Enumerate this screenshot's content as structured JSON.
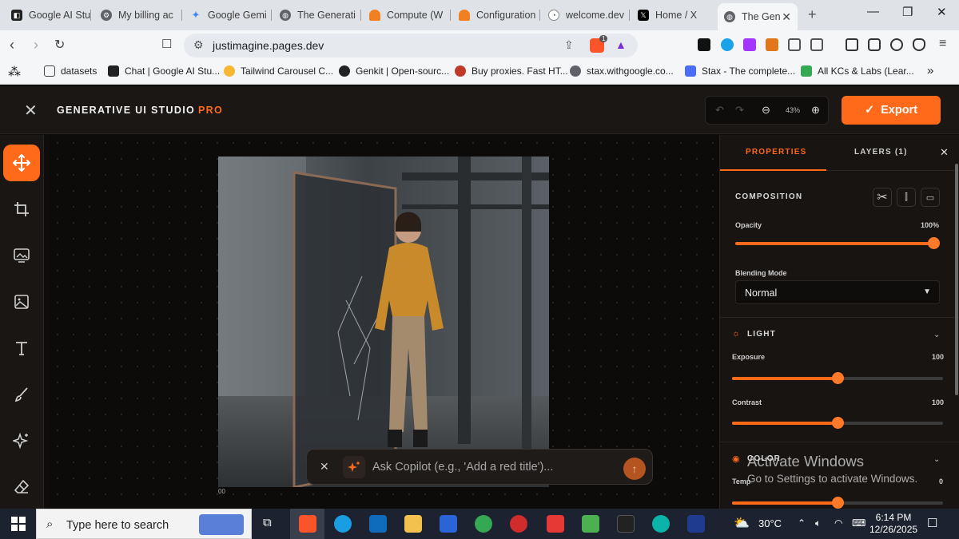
{
  "browser": {
    "tabs": [
      {
        "title": "Google AI Stu",
        "active": false
      },
      {
        "title": "My billing ac",
        "active": false
      },
      {
        "title": "Google Gemi",
        "active": false
      },
      {
        "title": "The Generati",
        "active": false
      },
      {
        "title": "Compute (W",
        "active": false
      },
      {
        "title": "Configuration",
        "active": false
      },
      {
        "title": "welcome.dev",
        "active": false
      },
      {
        "title": "Home / X",
        "active": false
      },
      {
        "title": "The Gen",
        "active": true
      }
    ],
    "url": "justimagine.pages.dev",
    "brave_badge": "1",
    "bookmarks": [
      "datasets",
      "Chat | Google AI Stu...",
      "Tailwind Carousel C...",
      "Genkit | Open-sourc...",
      "Buy proxies. Fast HT...",
      "stax.withgoogle.co...",
      "Stax - The complete...",
      "All KCs & Labs (Lear..."
    ],
    "bookmarks_more": "»"
  },
  "app": {
    "title": "GENERATIVE UI STUDIO",
    "title_badge": "PRO",
    "zoom": "43%",
    "export_label": "Export",
    "tools": [
      "move-icon",
      "crop-icon",
      "background-icon",
      "image-icon",
      "text-icon",
      "brush-icon",
      "magic-icon",
      "eraser-icon"
    ],
    "canvas_caption": "00",
    "copilot_placeholder": "Ask Copilot (e.g., 'Add a red title')..."
  },
  "panel": {
    "tab_properties": "PROPERTIES",
    "tab_layers": "LAYERS (1)",
    "composition_title": "COMPOSITION",
    "opacity_label": "Opacity",
    "opacity_value": "100%",
    "opacity_level": 1.0,
    "blending_label": "Blending Mode",
    "blending_value": "Normal",
    "light_title": "LIGHT",
    "exposure_label": "Exposure",
    "exposure_value": "100",
    "exposure_level": 0.5,
    "contrast_label": "Contrast",
    "contrast_value": "100",
    "contrast_level": 0.5,
    "color_title": "COLOR",
    "temp_label": "Temp",
    "temp_value": "0",
    "temp_level": 0.5
  },
  "watermark": {
    "line1": "Activate Windows",
    "line2": "Go to Settings to activate Windows."
  },
  "taskbar": {
    "search_placeholder": "Type here to search",
    "weather": "30°C",
    "time": "6:14 PM",
    "date": "12/26/2025"
  },
  "colors": {
    "accent": "#ff6a1a",
    "panel_bg": "#171412",
    "canvas_bg": "#0c0b0a"
  }
}
